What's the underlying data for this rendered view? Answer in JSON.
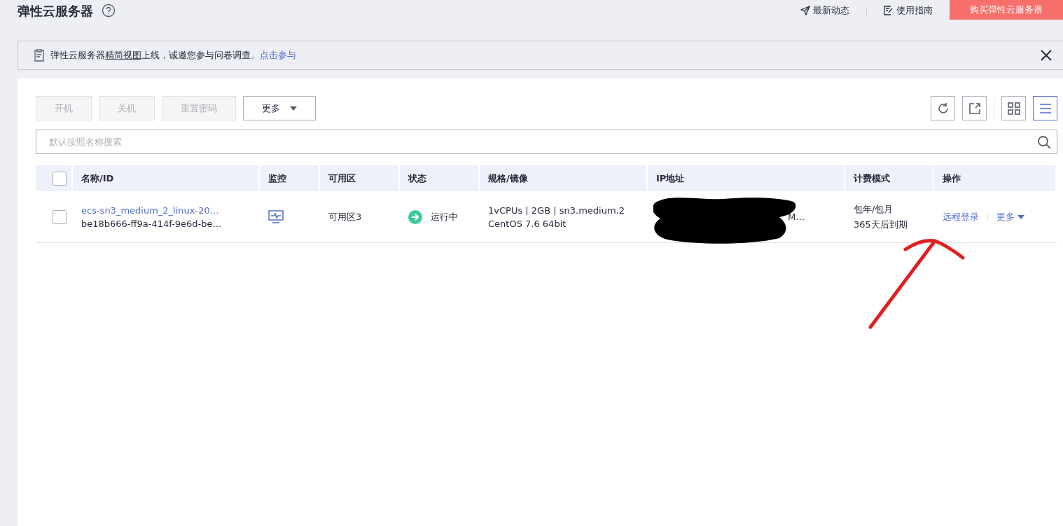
{
  "header": {
    "title": "弹性云服务器",
    "links": [
      {
        "kind": "news",
        "label": "最新动态"
      },
      {
        "kind": "guide",
        "label": "使用指南"
      }
    ],
    "buy_button": "购买弹性云服务器"
  },
  "notice": {
    "before": "弹性云服务器",
    "underlined": "精简视图",
    "after": "上线，诚邀您参与问卷调查。",
    "link": "点击参与"
  },
  "toolbar": {
    "buttons": [
      {
        "label": "开机",
        "disabled": true,
        "dropdown": false
      },
      {
        "label": "关机",
        "disabled": true,
        "dropdown": false
      },
      {
        "label": "重置密码",
        "disabled": true,
        "dropdown": false
      },
      {
        "label": "更多",
        "disabled": false,
        "dropdown": true
      }
    ],
    "views": [
      {
        "kind": "grid",
        "selected": false
      },
      {
        "kind": "list",
        "selected": true
      }
    ]
  },
  "search": {
    "placeholder": "默认按照名称搜索"
  },
  "table": {
    "select_all_checked": false,
    "columns": [
      "名称/ID",
      "监控",
      "可用区",
      "状态",
      "规格/镜像",
      "IP地址",
      "计费模式",
      "操作"
    ],
    "rows": [
      {
        "checked": false,
        "name": "ecs-sn3_medium_2_linux-20…",
        "id": "be18b666-ff9a-414f-9e6d-be…",
        "zone": "可用区3",
        "status": {
          "label": "运行中",
          "color": "#3ec99a"
        },
        "spec": [
          "1vCPUs | 2GB | sn3.medium.2",
          "CentOS 7.6 64bit"
        ],
        "ip": "M…",
        "billing": [
          "包年/包月",
          "365天后到期"
        ],
        "actions": [
          {
            "label": "远程登录",
            "dropdown": false
          },
          {
            "label": "更多",
            "dropdown": true
          }
        ]
      }
    ]
  }
}
